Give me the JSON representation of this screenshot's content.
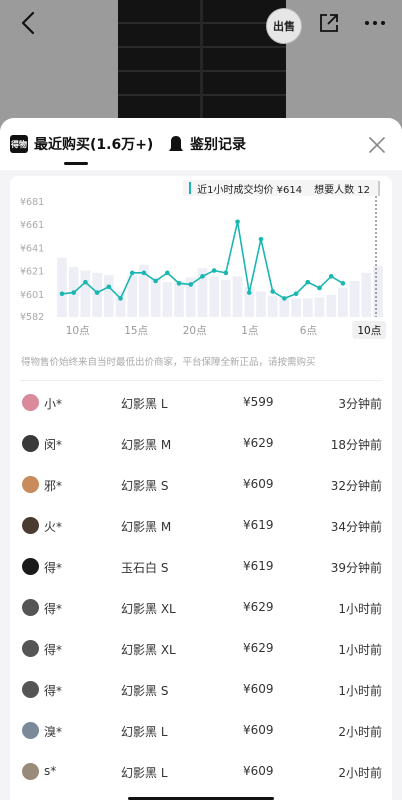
{
  "nav": {
    "sell_label": "出售",
    "back_icon": "back-arrow-icon",
    "share_icon": "share-icon",
    "more_icon": "more-icon"
  },
  "tabs": {
    "recent_label": "最近购买(1.6万+)",
    "recent_logo": "得物",
    "auth_label": "鉴别记录"
  },
  "legend": {
    "avg_label": "近1小时成交均价 ¥614",
    "wanted_label": "想要人数 12"
  },
  "chart_data": {
    "type": "bar",
    "ytick_labels": [
      "¥681",
      "¥661",
      "¥641",
      "¥621",
      "¥601",
      "¥582"
    ],
    "yticks": [
      681,
      661,
      641,
      621,
      601,
      582
    ],
    "ylim": [
      582,
      681
    ],
    "xtick_labels": [
      "10点",
      "15点",
      "20点",
      "1点",
      "6点",
      "10点"
    ],
    "xtick_positions": [
      1,
      6,
      11,
      16,
      21,
      26
    ],
    "highlight_xtick_index": 5,
    "series": [
      {
        "kind": "bars",
        "values": [
          [
            0,
            633
          ],
          [
            1,
            625
          ],
          [
            2,
            622
          ],
          [
            3,
            620
          ],
          [
            4,
            618
          ],
          [
            5,
            604
          ],
          [
            6,
            618
          ],
          [
            7,
            627
          ],
          [
            8,
            616
          ],
          [
            9,
            612
          ],
          [
            10,
            613
          ],
          [
            11,
            616
          ],
          [
            12,
            624
          ],
          [
            13,
            617
          ],
          [
            14,
            614
          ],
          [
            15,
            617
          ],
          [
            16,
            608
          ],
          [
            17,
            604
          ],
          [
            18,
            600
          ],
          [
            19,
            599
          ],
          [
            20,
            598
          ],
          [
            21,
            598
          ],
          [
            22,
            599
          ],
          [
            23,
            601
          ],
          [
            24,
            607
          ],
          [
            25,
            613
          ],
          [
            26,
            620
          ],
          [
            27,
            626
          ]
        ]
      },
      {
        "kind": "line",
        "color": "#1ab7b0",
        "values": [
          [
            0,
            602
          ],
          [
            1,
            603
          ],
          [
            2,
            612
          ],
          [
            3,
            603
          ],
          [
            4,
            608
          ],
          [
            5,
            598
          ],
          [
            6,
            620
          ],
          [
            7,
            620
          ],
          [
            8,
            613
          ],
          [
            9,
            620
          ],
          [
            10,
            611
          ],
          [
            11,
            610
          ],
          [
            12,
            617
          ],
          [
            13,
            622
          ],
          [
            14,
            620
          ],
          [
            15,
            664
          ],
          [
            16,
            603
          ],
          [
            17,
            649
          ],
          [
            18,
            604
          ],
          [
            19,
            598
          ],
          [
            20,
            602
          ],
          [
            21,
            612
          ],
          [
            22,
            607
          ],
          [
            23,
            617
          ],
          [
            24,
            611
          ]
        ]
      }
    ]
  },
  "notice": "得物售价始终来自当时最低出价商家，平台保障全新正品，请按需购买",
  "records": [
    {
      "user": "小*",
      "variant": "幻影黑 L",
      "price": "¥599",
      "time": "3分钟前",
      "avatar_color": "#d98a9c"
    },
    {
      "user": "闵*",
      "variant": "幻影黑 M",
      "price": "¥629",
      "time": "18分钟前",
      "avatar_color": "#3a3a3a"
    },
    {
      "user": "邪*",
      "variant": "幻影黑 S",
      "price": "¥609",
      "time": "32分钟前",
      "avatar_color": "#c98b5b"
    },
    {
      "user": "火*",
      "variant": "幻影黑 M",
      "price": "¥619",
      "time": "34分钟前",
      "avatar_color": "#4a3a30"
    },
    {
      "user": "得*",
      "variant": "玉石白 S",
      "price": "¥619",
      "time": "39分钟前",
      "avatar_color": "#1a1a1a"
    },
    {
      "user": "得*",
      "variant": "幻影黑 XL",
      "price": "¥629",
      "time": "1小时前",
      "avatar_color": "#555555"
    },
    {
      "user": "得*",
      "variant": "幻影黑 XL",
      "price": "¥629",
      "time": "1小时前",
      "avatar_color": "#555555"
    },
    {
      "user": "得*",
      "variant": "幻影黑 S",
      "price": "¥609",
      "time": "1小时前",
      "avatar_color": "#555555"
    },
    {
      "user": "溴*",
      "variant": "幻影黑 L",
      "price": "¥609",
      "time": "2小时前",
      "avatar_color": "#7a8a9a"
    },
    {
      "user": "s*",
      "variant": "幻影黑 L",
      "price": "¥609",
      "time": "2小时前",
      "avatar_color": "#9a8a7a"
    }
  ]
}
